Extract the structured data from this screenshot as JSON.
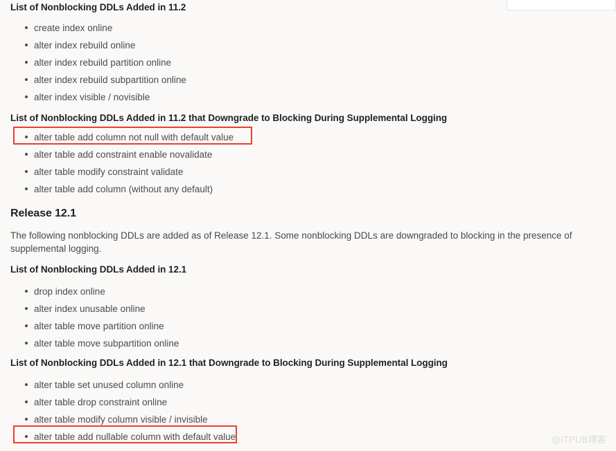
{
  "page": {
    "background_color": "#faf9f7",
    "watermark": "@ITPUB博客"
  },
  "highlight": {
    "color": "#f03c2e"
  },
  "sections": {
    "heading_11_2": "List of Nonblocking DDLs Added in 11.2",
    "list_11_2": [
      "create index online",
      "alter index rebuild online",
      "alter index rebuild partition online",
      "alter index rebuild subpartition online",
      "alter index visible / novisible"
    ],
    "heading_11_2_downgrade": "List of Nonblocking DDLs Added in 11.2 that Downgrade to Blocking During Supplemental Logging",
    "list_11_2_downgrade": [
      "alter table add column not null with default value",
      "alter table add constraint enable novalidate",
      "alter table modify constraint validate",
      "alter table add column (without any default)"
    ],
    "release_heading": "Release 12.1",
    "release_paragraph": "The following nonblocking DDLs are added as of Release 12.1. Some nonblocking DDLs are downgraded to blocking in the presence of supplemental logging.",
    "heading_12_1": "List of Nonblocking DDLs Added in 12.1",
    "list_12_1": [
      "drop index online",
      "alter index unusable online",
      "alter table move partition online",
      "alter table move subpartition online"
    ],
    "heading_12_1_downgrade": "List of Nonblocking DDLs Added in 12.1 that Downgrade to Blocking During Supplemental Logging",
    "list_12_1_downgrade": [
      "alter table set unused column online",
      "alter table drop constraint online",
      "alter table modify column visible / invisible",
      "alter table add nullable column with default value"
    ]
  }
}
